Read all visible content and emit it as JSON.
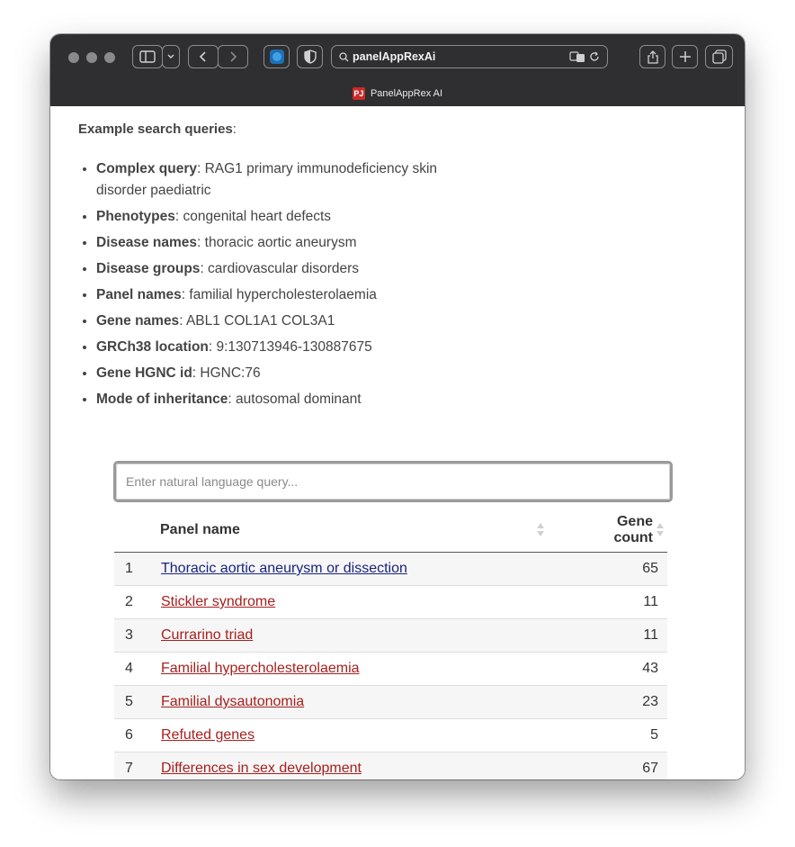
{
  "browser": {
    "url": "panelAppRexAi",
    "tab_title": "PanelAppRex AI",
    "favicon_text": "PJ"
  },
  "page": {
    "examples_heading": "Example search queries",
    "examples_colon": ":",
    "examples": [
      {
        "label": "Complex query",
        "value": ": RAG1 primary immunodeficiency skin disorder paediatric"
      },
      {
        "label": "Phenotypes",
        "value": ": congenital heart defects"
      },
      {
        "label": "Disease names",
        "value": ": thoracic aortic aneurysm"
      },
      {
        "label": "Disease groups",
        "value": ": cardiovascular disorders"
      },
      {
        "label": "Panel names",
        "value": ": familial hypercholesterolaemia"
      },
      {
        "label": "Gene names",
        "value": ": ABL1 COL1A1 COL3A1"
      },
      {
        "label": "GRCh38 location",
        "value": ": 9:130713946-130887675"
      },
      {
        "label": "Gene HGNC id",
        "value": ": HGNC:76"
      },
      {
        "label": "Mode of inheritance",
        "value": ": autosomal dominant"
      }
    ],
    "search": {
      "placeholder": "Enter natural language query...",
      "value": ""
    },
    "table": {
      "headers": {
        "index": "",
        "panel_name": "Panel name",
        "gene_count_line1": "Gene",
        "gene_count_line2": "count"
      },
      "rows": [
        {
          "index": "1",
          "name": "Thoracic aortic aneurysm or dissection",
          "count": "65",
          "visited": true
        },
        {
          "index": "2",
          "name": "Stickler syndrome",
          "count": "11",
          "visited": false
        },
        {
          "index": "3",
          "name": "Currarino triad",
          "count": "11",
          "visited": false
        },
        {
          "index": "4",
          "name": "Familial hypercholesterolaemia",
          "count": "43",
          "visited": false
        },
        {
          "index": "5",
          "name": "Familial dysautonomia",
          "count": "23",
          "visited": false
        },
        {
          "index": "6",
          "name": "Refuted genes",
          "count": "5",
          "visited": false
        },
        {
          "index": "7",
          "name": "Differences in sex development",
          "count": "67",
          "visited": false
        }
      ]
    }
  },
  "colors": {
    "link": "#a6201f",
    "visited_link": "#1a237e",
    "toolbar": "#2f2f31",
    "text": "#444444"
  }
}
